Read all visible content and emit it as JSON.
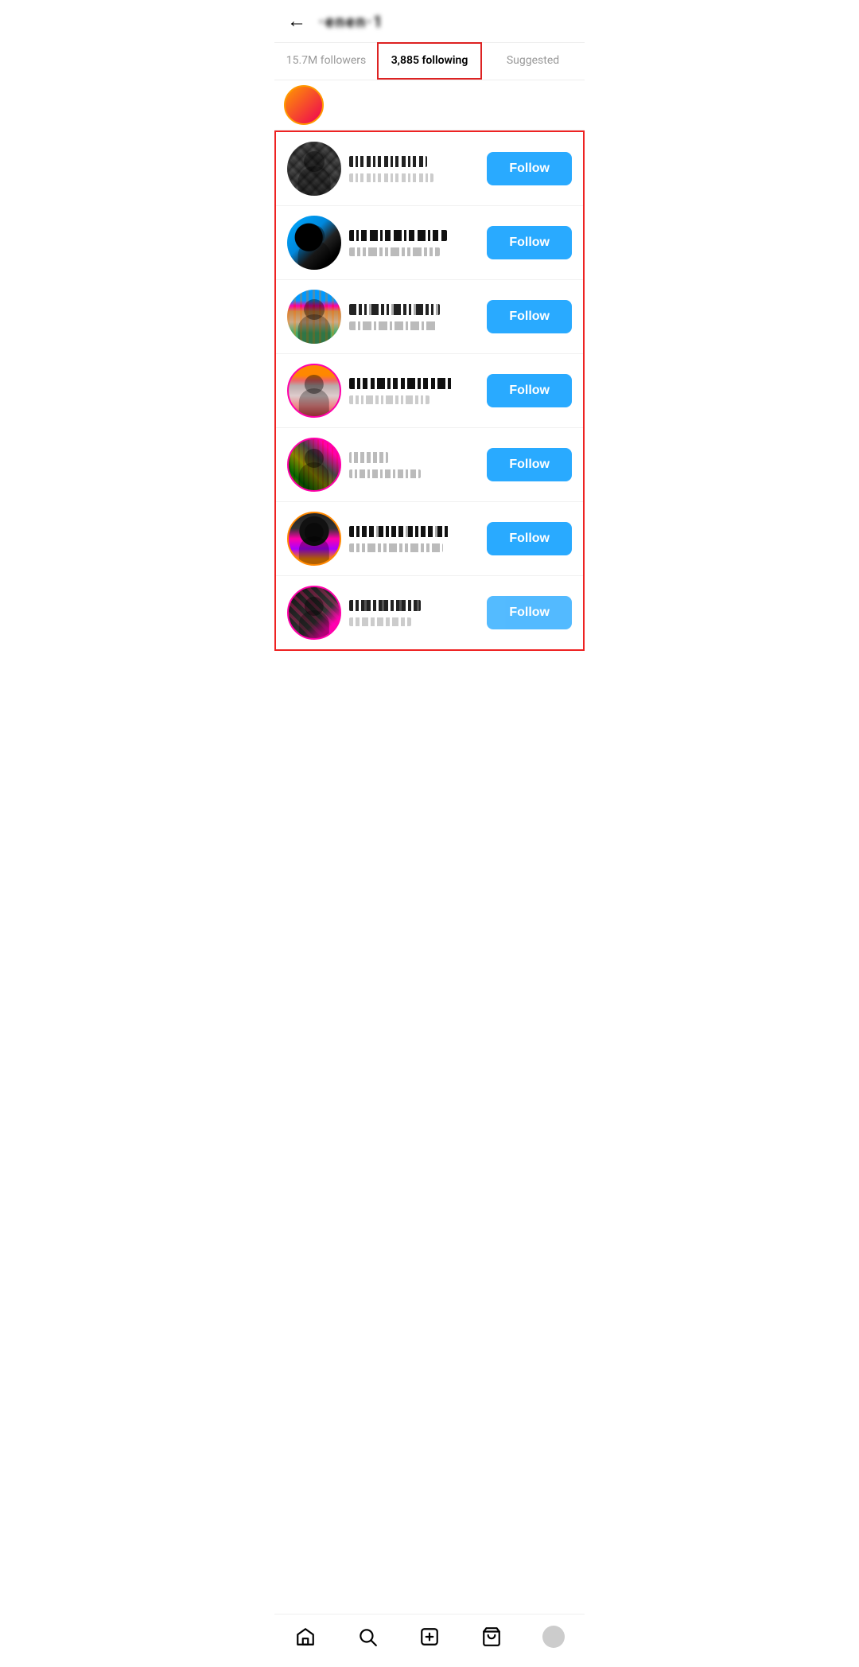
{
  "header": {
    "back_label": "←",
    "username": "jenergi",
    "username_display": "·enen·1"
  },
  "tabs": {
    "followers_label": "15.7M followers",
    "following_label": "3,885 following",
    "suggested_label": "Suggested"
  },
  "users": [
    {
      "id": 1,
      "follow_label": "Follow",
      "avatar_class": "avatar-1",
      "name_class": "name-v1",
      "handle_class": "handle-v1"
    },
    {
      "id": 2,
      "follow_label": "Follow",
      "avatar_class": "avatar-2",
      "name_class": "name-v2",
      "handle_class": "handle-v2"
    },
    {
      "id": 3,
      "follow_label": "Follow",
      "avatar_class": "avatar-3",
      "name_class": "name-v3",
      "handle_class": "handle-v3"
    },
    {
      "id": 4,
      "follow_label": "Follow",
      "avatar_class": "avatar-4",
      "name_class": "name-v4",
      "handle_class": "handle-v4"
    },
    {
      "id": 5,
      "follow_label": "Follow",
      "avatar_class": "avatar-5",
      "name_class": "name-v5",
      "handle_class": "handle-v5"
    },
    {
      "id": 6,
      "follow_label": "Follow",
      "avatar_class": "avatar-6",
      "name_class": "name-v6",
      "handle_class": "handle-v6"
    },
    {
      "id": 7,
      "follow_label": "Follow",
      "avatar_class": "avatar-7",
      "name_class": "name-v7",
      "handle_class": "handle-v7"
    }
  ],
  "bottom_nav": {
    "home_label": "Home",
    "search_label": "Search",
    "new_post_label": "New Post",
    "shop_label": "Shop",
    "profile_label": "Profile"
  }
}
